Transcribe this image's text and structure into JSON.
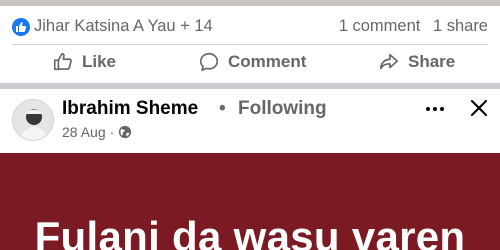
{
  "reactions": {
    "reactors_text": "Jihar Katsina A Yau + 14",
    "comment_count": "1 comment",
    "share_count": "1 share",
    "like_badge_color": "#1877f2"
  },
  "actions": {
    "like_label": "Like",
    "comment_label": "Comment",
    "share_label": "Share"
  },
  "post": {
    "author": "Ibrahim Sheme",
    "separator": "•",
    "follow_status": "Following",
    "date": "28 Aug",
    "meta_dot": "·",
    "audience_icon": "globe-icon",
    "image_background": "#7c1a24",
    "image_text": "Fulani da wasu varen"
  }
}
